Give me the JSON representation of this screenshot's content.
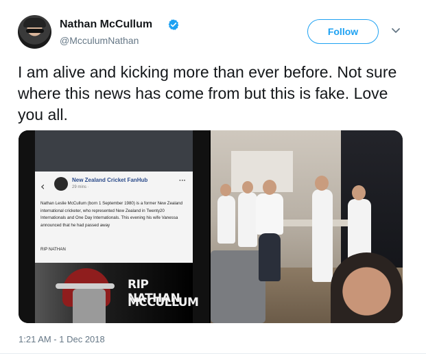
{
  "author": {
    "name": "Nathan McCullum",
    "handle": "@McculumNathan",
    "verified": true
  },
  "actions": {
    "follow_label": "Follow"
  },
  "tweet": {
    "text": "I am alive and kicking more than ever before. Not sure where this news has come from but this is fake. Love you all.",
    "timestamp": "1:21 AM - 1 Dec 2018"
  },
  "media_left": {
    "post_page": "New Zealand Cricket FanHub",
    "post_time": "29 mins ·",
    "post_body": "Nathan Leslie McCullum (born 1 September 1980) is a former New Zealand international cricketer, who represented New Zealand in Twenty20 Internationals and One Day Internationals. This evening his wife Vanessa announced that he had passed away",
    "post_rip": "RIP NATHAN",
    "poster_line1": "RIP NATHAN",
    "poster_line2": "MCCULLUM"
  },
  "colors": {
    "accent": "#1da1f2",
    "secondary_text": "#657786"
  }
}
